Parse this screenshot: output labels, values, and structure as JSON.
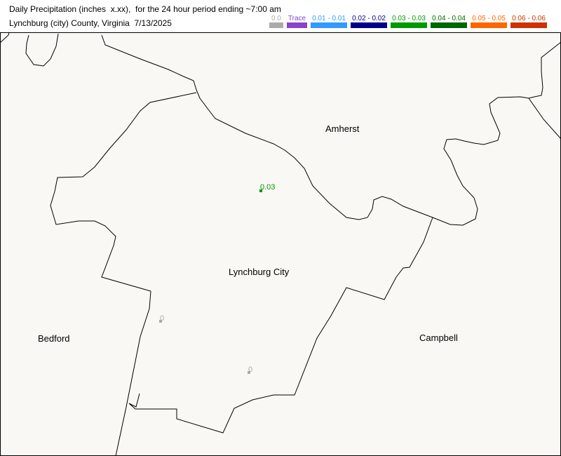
{
  "header": {
    "title_line1": "Daily Precipitation (inches  x.xx),  for the 24 hour period ending ~7:00 am",
    "title_line2": "Lynchburg (city) County, Virginia  7/13/2025"
  },
  "legend": [
    {
      "label": "0.0",
      "color": "#aaaaaa"
    },
    {
      "label": "Trace",
      "color": "#8844cc"
    },
    {
      "label": "0.01 - 0.01",
      "color": "#3399ff"
    },
    {
      "label": "0.02 - 0.02",
      "color": "#000088"
    },
    {
      "label": "0.03 - 0.03",
      "color": "#009900"
    },
    {
      "label": "0.04 - 0.04",
      "color": "#006600"
    },
    {
      "label": "0.05 - 0.05",
      "color": "#ff6600"
    },
    {
      "label": "0.06 - 0.06",
      "color": "#cc3300"
    }
  ],
  "map": {
    "background_color": "#faf8f4",
    "regions": {
      "amherst": "Amherst",
      "lynchburg_city": "Lynchburg City",
      "bedford": "Bedford",
      "campbell": "Campbell"
    },
    "stations": [
      {
        "value": "0.03",
        "color": "#009900"
      },
      {
        "value": "0",
        "color": "#aaaaaa"
      },
      {
        "value": "0",
        "color": "#aaaaaa"
      }
    ]
  }
}
